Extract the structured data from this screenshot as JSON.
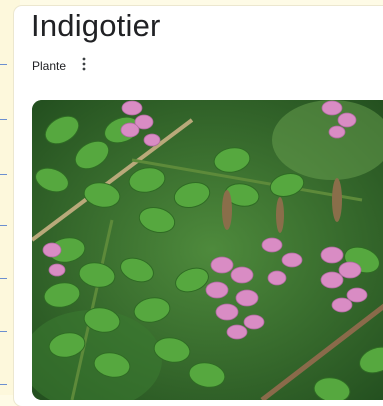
{
  "panel": {
    "title": "Indigotier",
    "subtitle": "Plante",
    "more_icon": "vertical-dots-icon",
    "image_alt": "Indigofera plant with green leaflets and pink flower spikes"
  },
  "colors": {
    "title_text": "#202124",
    "page_background": "#fefbe6",
    "leaf_green": "#4a9a3a",
    "flower_pink": "#d98cc4"
  }
}
